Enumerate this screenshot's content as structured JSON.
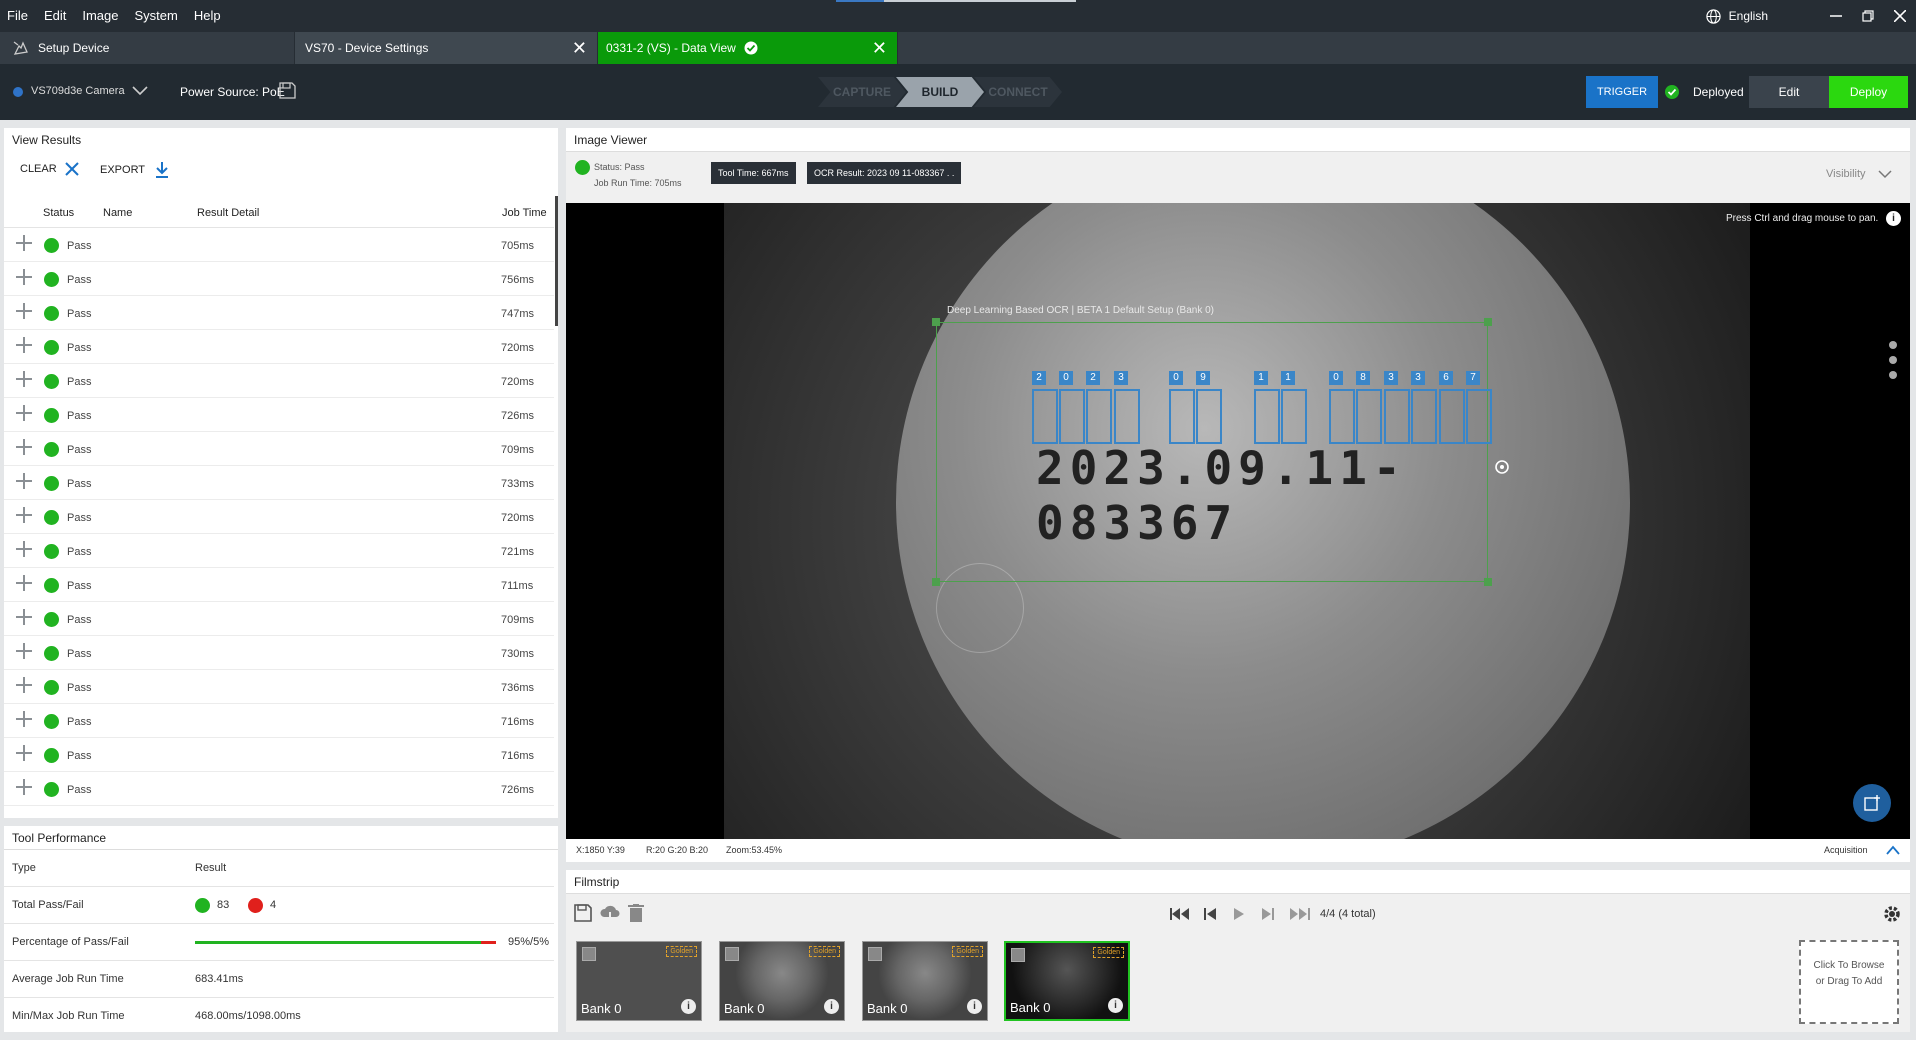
{
  "menu": [
    "File",
    "Edit",
    "Image",
    "System",
    "Help"
  ],
  "language": "English",
  "tabs": {
    "setup": "Setup Device",
    "settings": "VS70 - Device Settings",
    "dataview": "0331-2  (VS) - Data View"
  },
  "toolbar": {
    "camera": "VS709d3e Camera",
    "power": "Power Source: PoE",
    "steps": [
      "CAPTURE",
      "BUILD",
      "CONNECT"
    ],
    "trigger": "TRIGGER",
    "deployed": "Deployed",
    "edit": "Edit",
    "deploy": "Deploy"
  },
  "results": {
    "title": "View Results",
    "clear": "CLEAR",
    "export": "EXPORT",
    "columns": [
      "Status",
      "Name",
      "Result Detail",
      "Job Time"
    ],
    "rows": [
      {
        "status": "Pass",
        "time": "705ms"
      },
      {
        "status": "Pass",
        "time": "756ms"
      },
      {
        "status": "Pass",
        "time": "747ms"
      },
      {
        "status": "Pass",
        "time": "720ms"
      },
      {
        "status": "Pass",
        "time": "720ms"
      },
      {
        "status": "Pass",
        "time": "726ms"
      },
      {
        "status": "Pass",
        "time": "709ms"
      },
      {
        "status": "Pass",
        "time": "733ms"
      },
      {
        "status": "Pass",
        "time": "720ms"
      },
      {
        "status": "Pass",
        "time": "721ms"
      },
      {
        "status": "Pass",
        "time": "711ms"
      },
      {
        "status": "Pass",
        "time": "709ms"
      },
      {
        "status": "Pass",
        "time": "730ms"
      },
      {
        "status": "Pass",
        "time": "736ms"
      },
      {
        "status": "Pass",
        "time": "716ms"
      },
      {
        "status": "Pass",
        "time": "716ms"
      },
      {
        "status": "Pass",
        "time": "726ms"
      }
    ]
  },
  "performance": {
    "title": "Tool Performance",
    "col_type": "Type",
    "col_result": "Result",
    "total_label": "Total Pass/Fail",
    "pass_count": "83",
    "fail_count": "4",
    "pct_label": "Percentage of Pass/Fail",
    "pct_value": "95%/5%",
    "pass_fraction": 0.95,
    "avg_label": "Average Job Run Time",
    "avg_value": "683.41ms",
    "minmax_label": "Min/Max Job Run Time",
    "minmax_value": "468.00ms/1098.00ms"
  },
  "viewer": {
    "title": "Image Viewer",
    "status": "Status:  Pass",
    "runtime": "Job Run Time:  705ms",
    "tool_time": "Tool Time:  667ms",
    "ocr_result": "OCR Result:  2023 09 11-083367 . .",
    "visibility": "Visibility",
    "hint": "Press Ctrl and drag mouse to pan.",
    "roi_label": "Deep Learning Based OCR | BETA 1   Default Setup (Bank 0)",
    "digits": [
      "2",
      "0",
      "2",
      "3",
      "0",
      "9",
      "1",
      "1",
      "0",
      "8",
      "3",
      "3",
      "6",
      "7"
    ],
    "coords": "X:1850  Y:39",
    "rgb": "R:20  G:20  B:20",
    "zoom": "Zoom:53.45%",
    "acquisition": "Acquisition"
  },
  "filmstrip": {
    "title": "Filmstrip",
    "counter": "4/4 (4 total)",
    "bank": "Bank 0",
    "golden": "Golden",
    "add": "Click To Browse or Drag To Add"
  },
  "colors": {
    "accent_green": "#21b321",
    "tab_green": "#0a9a0a",
    "trigger_blue": "#1a73c8",
    "fail_red": "#e0201c"
  }
}
